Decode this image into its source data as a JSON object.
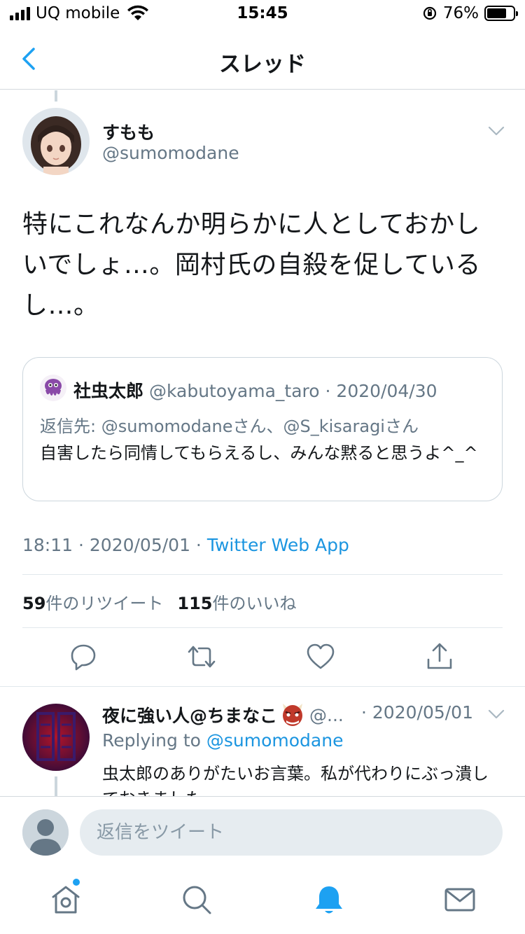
{
  "status_bar": {
    "carrier": "UQ mobile",
    "time": "15:45",
    "battery_percent": "76%",
    "battery_level": 0.76
  },
  "nav": {
    "title": "スレッド",
    "back_icon": "chevron-left-icon"
  },
  "main_tweet": {
    "author_name": "すもも",
    "author_handle": "@sumomodane",
    "text": "特にこれなんか明らかに人としておかしいでしょ…。岡村氏の自殺を促しているし…。",
    "quote": {
      "author_name": "社虫太郎",
      "author_handle": "@kabutoyama_taro",
      "date": "· 2020/04/30",
      "reply_prefix": "返信先:",
      "reply_targets": "@sumomodaneさん、@S_kisaragiさん",
      "text": "自害したら同情してもらえるし、みんな黙ると思うよ^_^"
    },
    "timestamp": "18:11 · 2020/05/01 · ",
    "source": "Twitter Web App",
    "retweet_count": "59",
    "retweet_label": "件のリツイート",
    "like_count": "115",
    "like_label": "件のいいね",
    "actions": [
      "reply-icon",
      "retweet-icon",
      "like-icon",
      "share-icon"
    ]
  },
  "reply_tweet": {
    "author_name": "夜に強い人@ちまなこ",
    "author_handle": "@...",
    "date": "· 2020/05/01",
    "replying_prefix": "Replying to ",
    "replying_to": "@sumomodane",
    "text": "虫太郎のありがたいお言葉。私が代わりにぶっ潰しておきました"
  },
  "compose": {
    "placeholder": "返信をツイート"
  },
  "tabs": [
    "home-icon",
    "search-icon",
    "notifications-icon",
    "messages-icon"
  ],
  "colors": {
    "accent": "#1da1f2",
    "link": "#1b95e0",
    "secondary_text": "#657786",
    "border": "#e1e8ed"
  }
}
